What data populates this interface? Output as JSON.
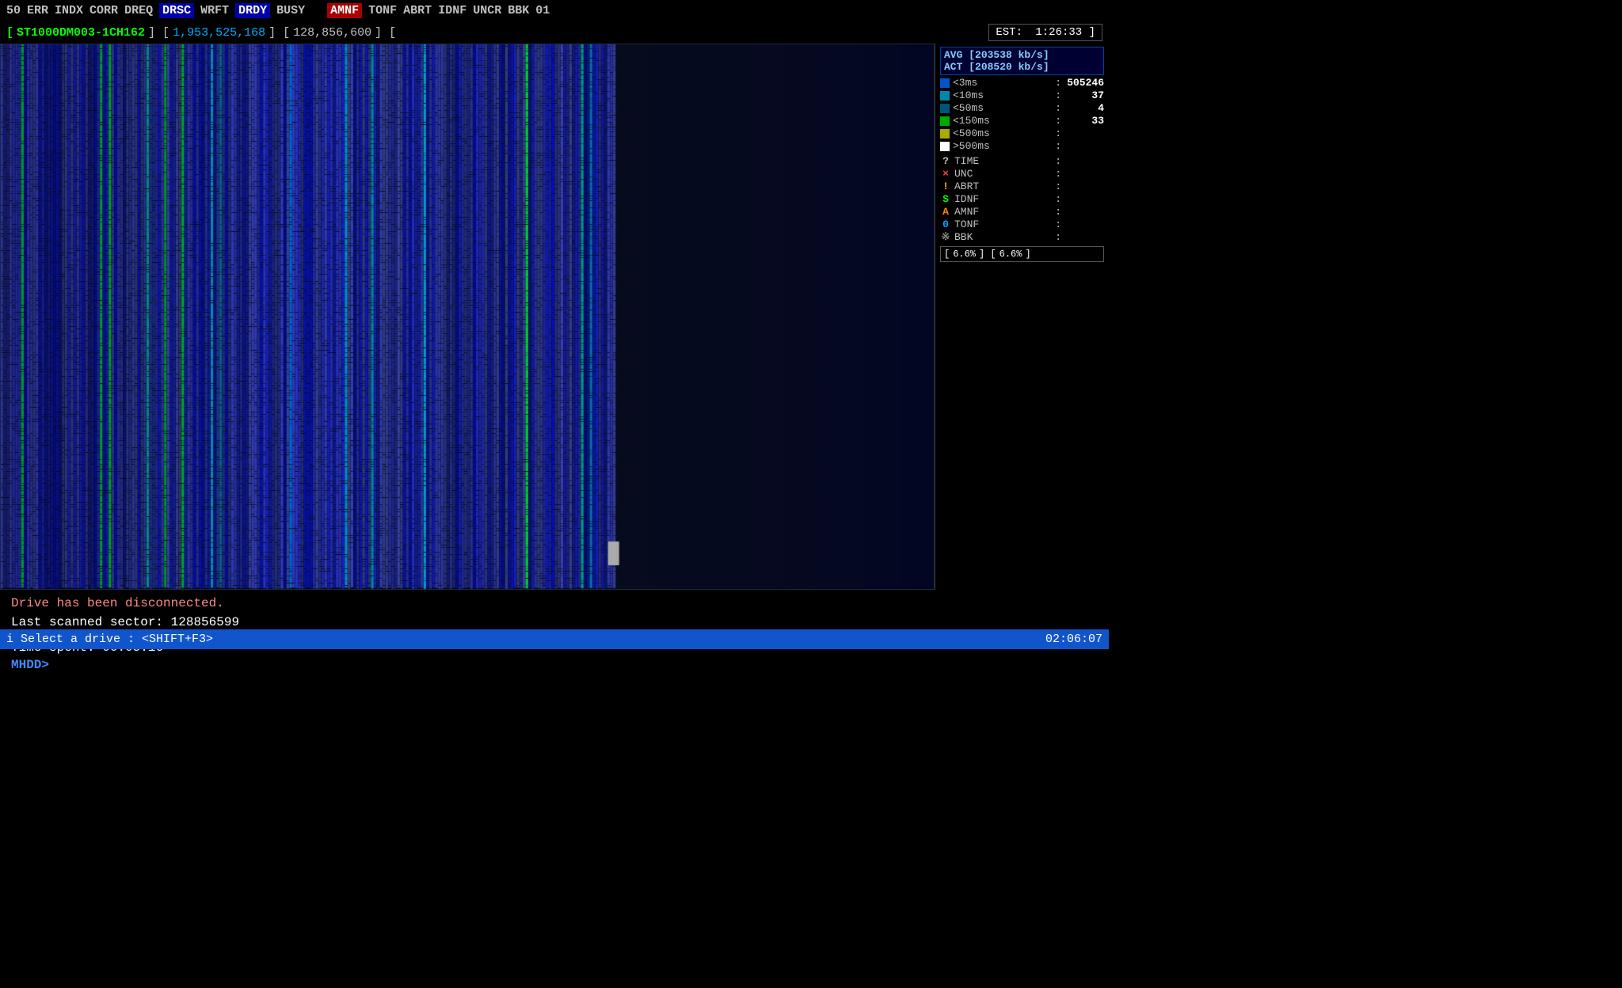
{
  "topbar": {
    "flags": [
      {
        "label": "50",
        "style": "normal"
      },
      {
        "label": "ERR",
        "style": "normal"
      },
      {
        "label": "INDX",
        "style": "normal"
      },
      {
        "label": "CORR",
        "style": "normal"
      },
      {
        "label": "DREQ",
        "style": "normal"
      },
      {
        "label": "DRSC",
        "style": "highlight-blue"
      },
      {
        "label": "WRFT",
        "style": "normal"
      },
      {
        "label": "DRDY",
        "style": "highlight-blue"
      },
      {
        "label": "BUSY",
        "style": "normal"
      },
      {
        "label": "AMNF",
        "style": "highlight-red"
      },
      {
        "label": "TONF",
        "style": "normal"
      },
      {
        "label": "ABRT",
        "style": "normal"
      },
      {
        "label": "IDNF",
        "style": "normal"
      },
      {
        "label": "UNCR",
        "style": "normal"
      },
      {
        "label": "BBK",
        "style": "normal"
      },
      {
        "label": "01",
        "style": "normal"
      }
    ]
  },
  "drivebar": {
    "bracket_open": "[",
    "drive_name": "ST1000DM003-1CH162",
    "bracket_mid": "] [",
    "total_sectors": "1,953,525,168",
    "bracket_mid2": "] [",
    "current_pos": "128,856,600",
    "bracket_close": "] [",
    "est_label": "EST:",
    "est_time": "1:26:33",
    "est_bracket": "]"
  },
  "right_panel": {
    "avg_label": "AVG",
    "avg_value": "[203538 kb/s]",
    "act_label": "ACT",
    "act_value": "[208520 kb/s]",
    "stats": [
      {
        "indicator": "blue",
        "label": "<3ms",
        "colon": ":",
        "value": "505246"
      },
      {
        "indicator": "cyan",
        "label": "<10ms",
        "colon": ":",
        "value": "37"
      },
      {
        "indicator": "cyan2",
        "label": "<50ms",
        "colon": ":",
        "value": "4"
      },
      {
        "indicator": "green",
        "label": "<150ms",
        "colon": ":",
        "value": "33"
      },
      {
        "indicator": "yellow",
        "label": "<500ms",
        "colon": ":",
        "value": ""
      },
      {
        "indicator": "orange",
        "label": ">500ms",
        "colon": ":",
        "value": ""
      }
    ],
    "symbols": [
      {
        "sym": "?",
        "class": "sym-q",
        "label": "TIME",
        "colon": ":",
        "value": ""
      },
      {
        "sym": "×",
        "class": "sym-x",
        "label": "UNC",
        "colon": ":",
        "value": ""
      },
      {
        "sym": "!",
        "class": "sym-excl",
        "label": "ABRT",
        "colon": ":",
        "value": ""
      },
      {
        "sym": "S",
        "class": "sym-s",
        "label": "IDNF",
        "colon": ":",
        "value": ""
      },
      {
        "sym": "A",
        "class": "sym-a",
        "label": "AMNF",
        "colon": ":",
        "value": ""
      },
      {
        "sym": "0",
        "class": "sym-0",
        "label": "TONF",
        "colon": ":",
        "value": ""
      },
      {
        "sym": "※",
        "class": "sym-star",
        "label": "BBK",
        "colon": ":",
        "value": ""
      }
    ],
    "progress_left": "6.6%",
    "progress_right": "6.6%"
  },
  "messages": {
    "disconnected": "Drive has been disconnected.",
    "last_sector_label": "Last scanned sector:",
    "last_sector_value": "128856599",
    "time_label": "Time spent:",
    "time_value": "00:05:16",
    "prompt": "MHDD>"
  },
  "statusbar": {
    "left": "i Select a drive : <SHIFT+F3>",
    "right": "02:06:07"
  }
}
